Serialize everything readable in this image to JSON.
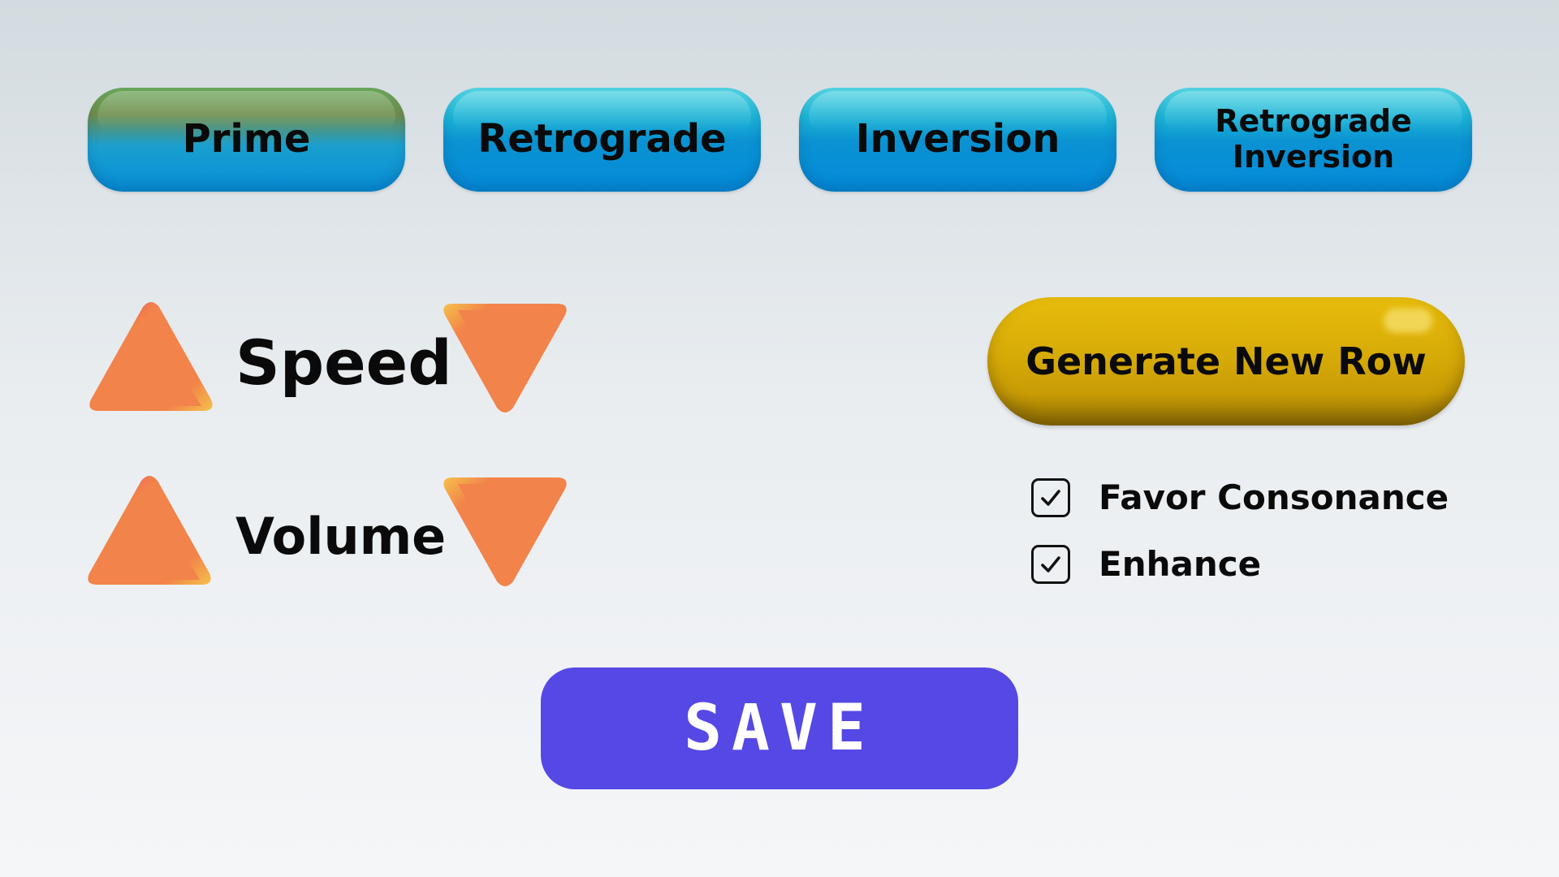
{
  "transforms": [
    {
      "label": "Prime",
      "active": true
    },
    {
      "label": "Retrograde",
      "active": false
    },
    {
      "label": "Inversion",
      "active": false
    },
    {
      "label": "Retrograde Inversion",
      "active": false
    }
  ],
  "controls": {
    "speed_label": "Speed",
    "volume_label": "Volume"
  },
  "generate": {
    "label": "Generate New Row"
  },
  "options": [
    {
      "label": "Favor Consonance",
      "checked": true
    },
    {
      "label": "Enhance",
      "checked": true
    }
  ],
  "save": {
    "label": "SAVE"
  },
  "icons": {
    "increase": "triangle-up-icon",
    "decrease": "triangle-down-icon",
    "check": "checkmark-icon"
  },
  "colors": {
    "transform_blue": "#0a92d2",
    "triangle_orange": "#f2834a",
    "generate_gold": "#d7ab07",
    "save_purple": "#5548e4"
  }
}
